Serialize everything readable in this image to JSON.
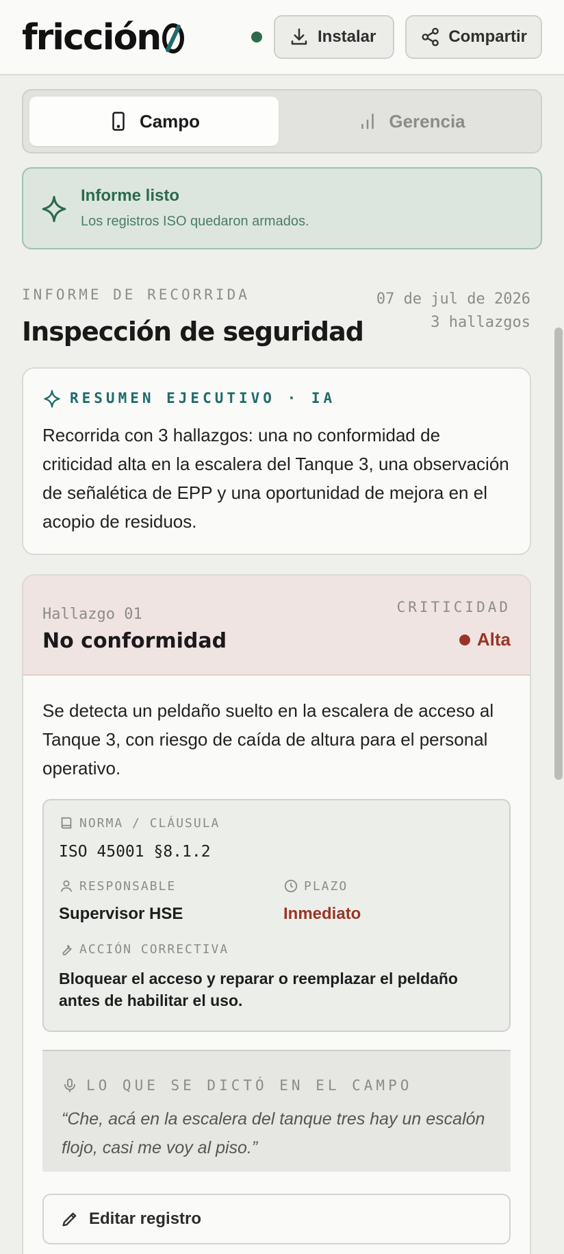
{
  "header": {
    "logo_text": "fricción",
    "install_label": "Instalar",
    "share_label": "Compartir",
    "status_color": "#2e6b4d"
  },
  "tabs": [
    {
      "label": "Campo",
      "icon": "phone-icon",
      "active": true
    },
    {
      "label": "Gerencia",
      "icon": "bar-chart-icon",
      "active": false
    }
  ],
  "alert": {
    "title": "Informe listo",
    "text": "Los registros ISO quedaron armados.",
    "icon": "sparkle-icon"
  },
  "report": {
    "kicker": "INFORME DE RECORRIDA",
    "title": "Inspección de seguridad",
    "date": "07 de jul de 2026",
    "findings_count": "3 hallazgos"
  },
  "summary": {
    "label": "RESUMEN EJECUTIVO · IA",
    "text": "Recorrida con 3 hallazgos: una no conformidad de criticidad alta en la escalera del Tanque 3, una observación de señalética de EPP y una oportunidad de mejora en el acopio de residuos."
  },
  "finding": {
    "number": "Hallazgo 01",
    "type": "No conformidad",
    "criticality_label": "CRITICIDAD",
    "criticality_value": "Alta",
    "criticality_color": "#9a3526",
    "description": "Se detecta un peldaño suelto en la escalera de acceso al Tanque 3, con riesgo de caída de altura para el personal operativo.",
    "norm_label": "NORMA / CLÁUSULA",
    "norm_value": "ISO 45001 §8.1.2",
    "responsible_label": "RESPONSABLE",
    "responsible_value": "Supervisor HSE",
    "deadline_label": "PLAZO",
    "deadline_value": "Inmediato",
    "action_label": "ACCIÓN CORRECTIVA",
    "action_value": "Bloquear el acceso y reparar o reemplazar el peldaño antes de habilitar el uso.",
    "dictation_label": "LO QUE SE DICTÓ EN EL CAMPO",
    "dictation_text": "“Che, acá en la escalera del tanque tres hay un escalón flojo, casi me voy al piso.”",
    "edit_label": "Editar registro"
  }
}
